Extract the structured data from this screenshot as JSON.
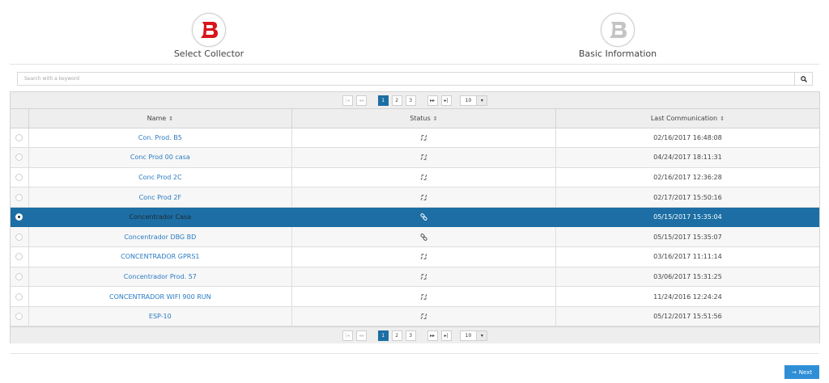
{
  "wizard": {
    "steps": [
      {
        "label": "Select Collector",
        "logo_color": "#d9141b"
      },
      {
        "label": "Basic Information",
        "logo_color": "#bdbdbd"
      }
    ]
  },
  "search": {
    "placeholder": "Search with a keyword"
  },
  "pager": {
    "pages": [
      "1",
      "2",
      "3"
    ],
    "active_page": "1",
    "rows_per_page": "10"
  },
  "table": {
    "columns": [
      {
        "label": "Name"
      },
      {
        "label": "Status"
      },
      {
        "label": "Last Communication"
      }
    ],
    "rows": [
      {
        "name": "Con. Prod. B5",
        "status": "disconnected",
        "last": "02/16/2017 16:48:08",
        "selected": false
      },
      {
        "name": "Conc Prod 00 casa",
        "status": "disconnected",
        "last": "04/24/2017 18:11:31",
        "selected": false
      },
      {
        "name": "Conc Prod 2C",
        "status": "disconnected",
        "last": "02/16/2017 12:36:28",
        "selected": false
      },
      {
        "name": "Conc Prod 2F",
        "status": "disconnected",
        "last": "02/17/2017 15:50:16",
        "selected": false
      },
      {
        "name": "Concentrador Casa",
        "status": "connected",
        "last": "05/15/2017 15:35:04",
        "selected": true
      },
      {
        "name": "Concentrador DBG BD",
        "status": "connected",
        "last": "05/15/2017 15:35:07",
        "selected": false
      },
      {
        "name": "CONCENTRADOR GPRS1",
        "status": "disconnected",
        "last": "03/16/2017 11:11:14",
        "selected": false
      },
      {
        "name": "Concentrador Prod. 57",
        "status": "disconnected",
        "last": "03/06/2017 15:31:25",
        "selected": false
      },
      {
        "name": "CONCENTRADOR WIFI 900 RUN",
        "status": "disconnected",
        "last": "11/24/2016 12:24:24",
        "selected": false
      },
      {
        "name": "ESP-10",
        "status": "disconnected",
        "last": "05/12/2017 15:51:56",
        "selected": false
      }
    ]
  },
  "footer": {
    "next_label": "Next"
  },
  "icons": {
    "search": "search-icon",
    "first": "first-page-icon",
    "prev": "prev-page-icon",
    "next": "next-page-icon",
    "last": "last-page-icon",
    "sort": "sort-icon",
    "connected": "link-icon",
    "disconnected": "broken-link-icon"
  },
  "colors": {
    "accent": "#1c6ea4",
    "link": "#2a7bc3",
    "button": "#2f8fd6",
    "brand_red": "#d9141b"
  }
}
